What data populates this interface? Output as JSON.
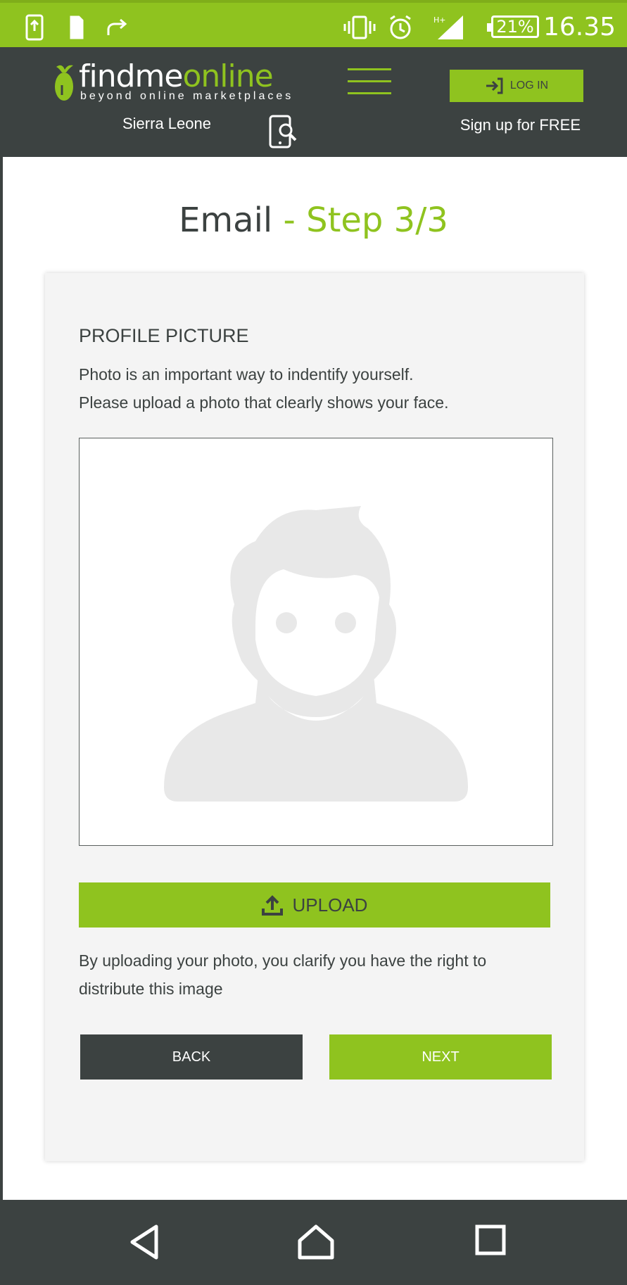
{
  "status_bar": {
    "time": "16.35",
    "battery": "21%",
    "network": "H+",
    "colors": {
      "background": "#8fc31f",
      "foreground": "#ffffff"
    },
    "icons": [
      "screenshot-icon",
      "sim-icon",
      "share-icon",
      "vibrate-icon",
      "alarm-icon",
      "signal-icon",
      "battery-icon"
    ]
  },
  "header": {
    "logo": {
      "word_part1": "findme",
      "word_part2": "online",
      "tagline": "beyond online marketplaces"
    },
    "country": "Sierra Leone",
    "login_label": "LOG IN",
    "signup_label": "Sign up for FREE",
    "colors": {
      "background": "#3c4241",
      "accent": "#8fc31f"
    }
  },
  "page": {
    "title_main": "Email",
    "title_step": "- Step 3/3"
  },
  "card": {
    "section_title": "PROFILE PICTURE",
    "description_line1": "Photo is an important way to indentify yourself.",
    "description_line2": "Please upload a photo that clearly shows your face.",
    "upload_label": "UPLOAD",
    "disclaimer": "By uploading your photo, you clarify you have the right to distribute this image",
    "back_label": "BACK",
    "next_label": "NEXT"
  },
  "nav_bar": {
    "icons": [
      "back-triangle-icon",
      "home-icon",
      "recents-icon"
    ]
  }
}
